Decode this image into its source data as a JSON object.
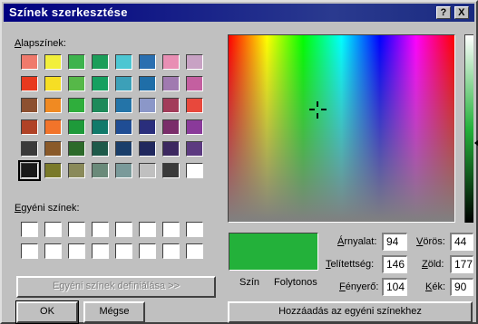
{
  "window": {
    "title": "Színek szerkesztése",
    "help_glyph": "?",
    "close_glyph": "X"
  },
  "basic": {
    "label_u": "A",
    "label_rest": "lapszínek:",
    "colors": [
      [
        "#ef7a6c",
        "#f2ef3b",
        "#3db34d",
        "#1c9e5a",
        "#4cc6d2",
        "#2a6fb0",
        "#e88fb4",
        "#c8a2c4"
      ],
      [
        "#e8391e",
        "#f6de24",
        "#56b848",
        "#16a060",
        "#3ca0b8",
        "#1f6ea8",
        "#a07ab0",
        "#c45fa0"
      ],
      [
        "#8c5030",
        "#f08a22",
        "#2fae3c",
        "#1e8a5a",
        "#2474a8",
        "#8b97c8",
        "#a23c5a",
        "#e8483c"
      ],
      [
        "#b04226",
        "#f2742a",
        "#1e9a3a",
        "#117a6a",
        "#1f4d94",
        "#2a2e7c",
        "#7a2d6a",
        "#8a3a9a"
      ],
      [
        "#3a3a3a",
        "#8a5a2a",
        "#2c6a2a",
        "#1e5a4a",
        "#1a3e6a",
        "#20285e",
        "#3c2860",
        "#5c3a80"
      ],
      [
        "#1a1a1a",
        "#7a7a2a",
        "#8a8a5a",
        "#6a8a7a",
        "#7a9a9a",
        "#c0c0c0",
        "#3a3a3a",
        "#ffffff"
      ]
    ]
  },
  "custom": {
    "label_u": "E",
    "label_rest": "gyéni színek:",
    "colors": [
      [
        "#ffffff",
        "#ffffff",
        "#ffffff",
        "#ffffff",
        "#ffffff",
        "#ffffff",
        "#ffffff",
        "#ffffff"
      ],
      [
        "#ffffff",
        "#ffffff",
        "#ffffff",
        "#ffffff",
        "#ffffff",
        "#ffffff",
        "#ffffff",
        "#ffffff"
      ]
    ]
  },
  "buttons": {
    "define": "Egyéni színek definiálása >>",
    "ok": "OK",
    "cancel": "Mégse",
    "add": "Hozzáadás az egyéni színekhez"
  },
  "preview": {
    "color": "#23b13a",
    "label_color": "Szín",
    "label_solid": "Folytonos"
  },
  "fields": {
    "hue": {
      "label_u": "Á",
      "label_rest": "rnyalat:",
      "value": "94"
    },
    "sat": {
      "label_u": "T",
      "label_rest": "elítettség:",
      "value": "146"
    },
    "lum": {
      "label_u": "F",
      "label_rest": "ényerő:",
      "value": "104"
    },
    "red": {
      "label_u": "V",
      "label_rest": "örös:",
      "value": "44"
    },
    "green": {
      "label_u": "Z",
      "label_rest": "öld:",
      "value": "177"
    },
    "blue": {
      "label_u": "K",
      "label_rest": "ék:",
      "value": "90"
    }
  }
}
